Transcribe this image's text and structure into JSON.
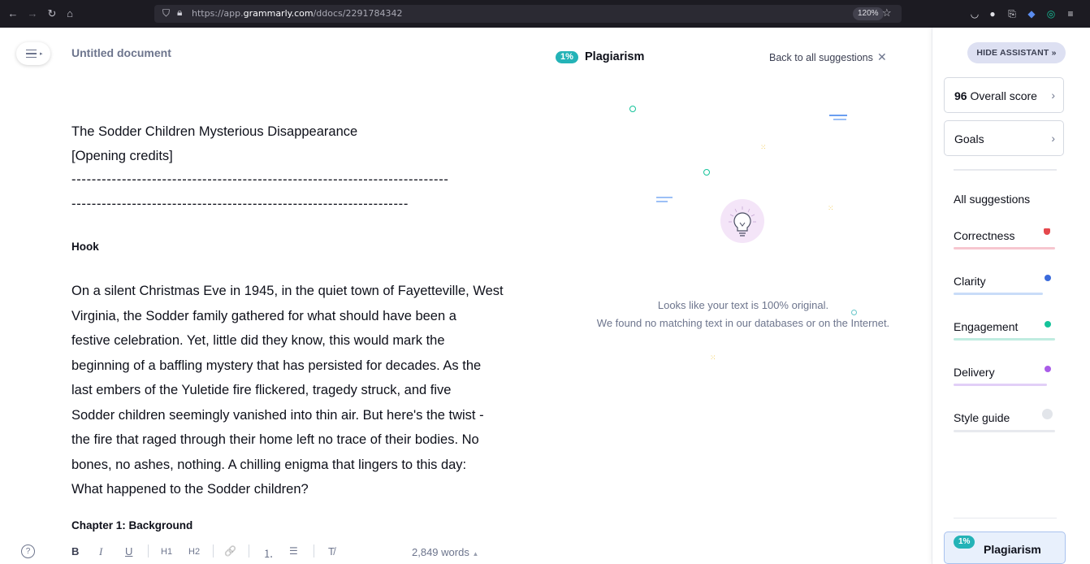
{
  "browser": {
    "url_prefix": "https://app.",
    "url_host": "grammarly.com",
    "url_path": "/ddocs/2291784342",
    "zoom": "120%"
  },
  "editor": {
    "doc_title": "Untitled document",
    "title_line": "The Sodder Children Mysterious Disappearance",
    "credits_line": "[Opening credits]",
    "dash_line_1": "---------------------------------------------------------------------------",
    "dash_line_2": "-------------------------------------------------------------------",
    "hook_heading": "Hook",
    "paragraph_lines": [
      "On a silent Christmas Eve in 1945, in the quiet town of Fayetteville, West",
      "Virginia, the Sodder family gathered for what should have been a",
      "festive celebration. Yet, little did they know, this would mark the",
      "beginning of a baffling mystery that has persisted for decades. As the",
      "last embers of the Yuletide fire flickered, tragedy struck, and five",
      "Sodder children seemingly vanished into thin air. But here's the twist -",
      "the fire that raged through their home left no trace of their bodies. No",
      "bones, no ashes, nothing. A chilling enigma that lingers to this day:",
      "What happened to the Sodder children?"
    ],
    "chapter_heading": "Chapter 1: Background"
  },
  "toolbar": {
    "help": "?",
    "bold": "B",
    "italic": "I",
    "underline": "U",
    "h1": "H1",
    "h2": "H2",
    "link": "🔗",
    "numbered_list": "⒈",
    "bulleted_list": "☰",
    "clear_format": "T̸",
    "word_count": "2,849 words",
    "word_count_arrow": "▲"
  },
  "plagiarism_panel": {
    "badge": "1%",
    "title": "Plagiarism",
    "back_link": "Back to all suggestions",
    "close": "✕",
    "message_1": "Looks like your text is 100% original.",
    "message_2": "We found no matching text in our databases or on the Internet."
  },
  "assistant": {
    "hide_button": "HIDE ASSISTANT",
    "hide_button_arrow": "»",
    "overall_score_value": "96",
    "overall_score_label": "Overall score",
    "goals_label": "Goals",
    "all_suggestions": "All suggestions",
    "categories": [
      {
        "label": "Correctness",
        "color": "#e5484d",
        "bar": "#f7c6cf"
      },
      {
        "label": "Clarity",
        "color": "#3b6bdb",
        "bar": "#c9dcf8"
      },
      {
        "label": "Engagement",
        "color": "#15c39a",
        "bar": "#bfece0"
      },
      {
        "label": "Delivery",
        "color": "#a95ce8",
        "bar": "#e2cff7"
      },
      {
        "label": "Style guide",
        "color": "#e2e5ea",
        "bar": "#e7e9ee"
      }
    ],
    "plagiarism_badge": "1%",
    "plagiarism_label": "Plagiarism"
  }
}
